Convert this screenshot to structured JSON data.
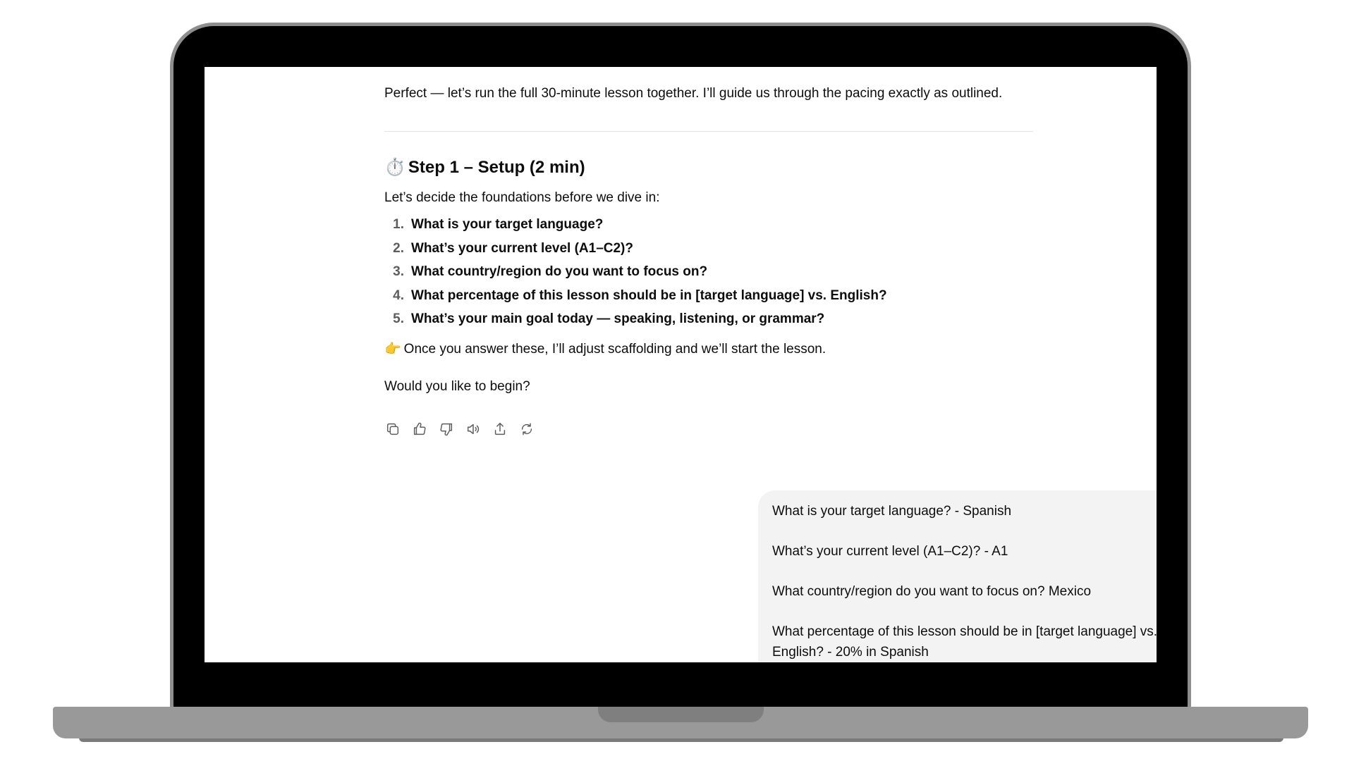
{
  "assistant_message": {
    "intro": "Perfect — let’s run the full 30-minute lesson together. I’ll guide us through the pacing exactly as outlined.",
    "step_heading": {
      "emoji": "⏱️",
      "text": "Step 1 – Setup (2 min)"
    },
    "lead": "Let’s decide the foundations before we dive in:",
    "questions": [
      {
        "num": "1.",
        "text": "What is your target language?"
      },
      {
        "num": "2.",
        "text": "What’s your current level (A1–C2)?"
      },
      {
        "num": "3.",
        "text": "What country/region do you want to focus on?"
      },
      {
        "num": "4.",
        "text": "What percentage of this lesson should be in [target language] vs. English?"
      },
      {
        "num": "5.",
        "text": "What’s your main goal today — speaking, listening, or grammar?"
      }
    ],
    "note": {
      "emoji": "👉",
      "text": "Once you answer these, I’ll adjust scaffolding and we’ll start the lesson."
    },
    "ask": "Would you like to begin?",
    "actions": [
      "copy-icon",
      "thumbs-up-icon",
      "thumbs-down-icon",
      "read-aloud-icon",
      "share-icon",
      "regenerate-icon"
    ]
  },
  "user_message": {
    "lines": [
      "What is your target language? - Spanish",
      "What’s your current level (A1–C2)? - A1",
      "What country/region do you want to focus on? Mexico",
      "What percentage of this lesson should be in [target language] vs. English? - 20% in Spanish"
    ]
  },
  "colors": {
    "laptop_bezel": "#000000",
    "laptop_frame": "#8e8e8e",
    "laptop_base": "#999999",
    "user_bubble_bg": "#f3f3f3",
    "text": "#0d0d0d",
    "icon": "#5d5d5d"
  }
}
